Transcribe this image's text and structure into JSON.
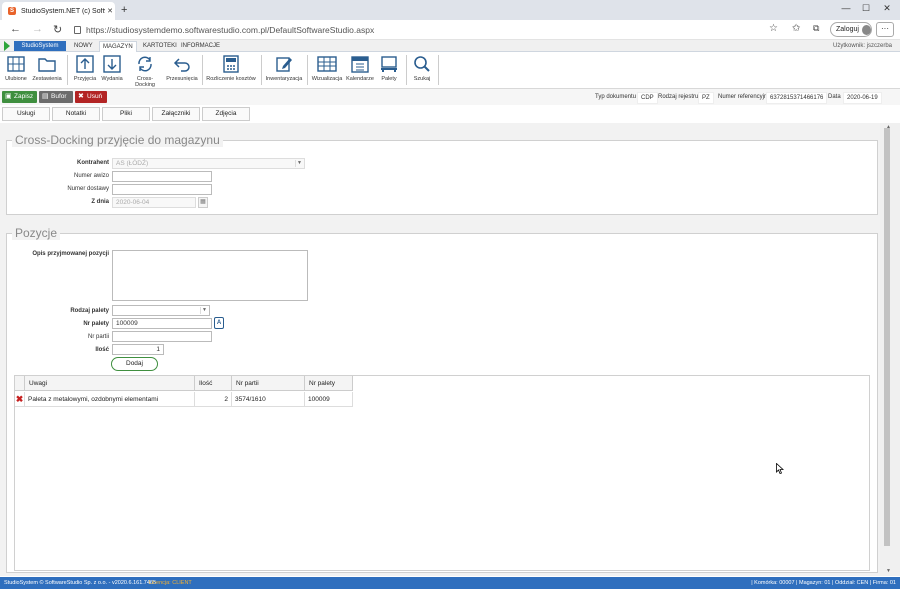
{
  "browser": {
    "tab_title": "StudioSystem.NET (c) SoftwareStu",
    "favicon": "S",
    "url": "https://studiosystemdemo.softwarestudio.com.pl/DefaultSoftwareStudio.aspx",
    "login_label": "Zaloguj"
  },
  "menu": {
    "brand": "StudioSystem",
    "tabs": [
      "NOWY",
      "MAGAZYN",
      "KARTOTEKI",
      "INFORMACJE"
    ],
    "active_tab": "MAGAZYN",
    "user_label": "Użytkownik: jszczerba"
  },
  "ribbon": [
    "Ulubione",
    "Zestawienia",
    "Przyjęcia",
    "Wydania",
    "Cross-Docking",
    "Przesunięcia",
    "Rozliczenie kosztów",
    "Inwentaryzacja",
    "Wizualizacja",
    "Kalendarze",
    "Palety",
    "Szukaj"
  ],
  "actions": {
    "save": "Zapisz",
    "buffer": "Bufor",
    "delete": "Usuń"
  },
  "doc_meta": {
    "type_label": "Typ dokumentu",
    "type_value": "CDP",
    "register_label": "Rodzaj rejestru",
    "register_value": "PZ",
    "ref_label": "Numer referencyjny",
    "ref_value": "6372815371466176",
    "date_label": "Data",
    "date_value": "2020-06-19"
  },
  "subtabs": [
    "Usługi",
    "Notatki",
    "Pliki",
    "Załączniki",
    "Zdjęcia"
  ],
  "header_section": {
    "title": "Cross-Docking przyjęcie do magazynu",
    "contractor_label": "Kontrahent",
    "contractor_value": "AS (ŁÓDŹ)",
    "advice_label": "Numer awizo",
    "advice_value": "",
    "delivery_label": "Numer dostawy",
    "delivery_value": "",
    "date_label": "Z dnia",
    "date_value": "2020-06-04"
  },
  "positions": {
    "title": "Pozycje",
    "desc_label": "Opis przyjmowanej pozycji",
    "pallet_type_label": "Rodzaj palety",
    "pallet_type_value": "",
    "pallet_no_label": "Nr palety",
    "pallet_no_value": "100009",
    "batch_label": "Nr partii",
    "batch_value": "",
    "qty_label": "Ilość",
    "qty_value": "1",
    "add_label": "Dodaj"
  },
  "grid": {
    "columns": [
      "Uwagi",
      "Ilość",
      "Nr partii",
      "Nr palety"
    ],
    "rows": [
      [
        "Paleta z metalowymi, ozdobnymi elementami",
        "2",
        "3574/1610",
        "100009"
      ]
    ]
  },
  "status": {
    "left": "StudioSystem © SoftwareStudio Sp. z o.o. - v2020.6.161.7465",
    "license": "Licencja: CLIENT",
    "right": "| Komórka: 00007 | Magazyn: 01 | Oddział: CEN | Firma: 01"
  }
}
